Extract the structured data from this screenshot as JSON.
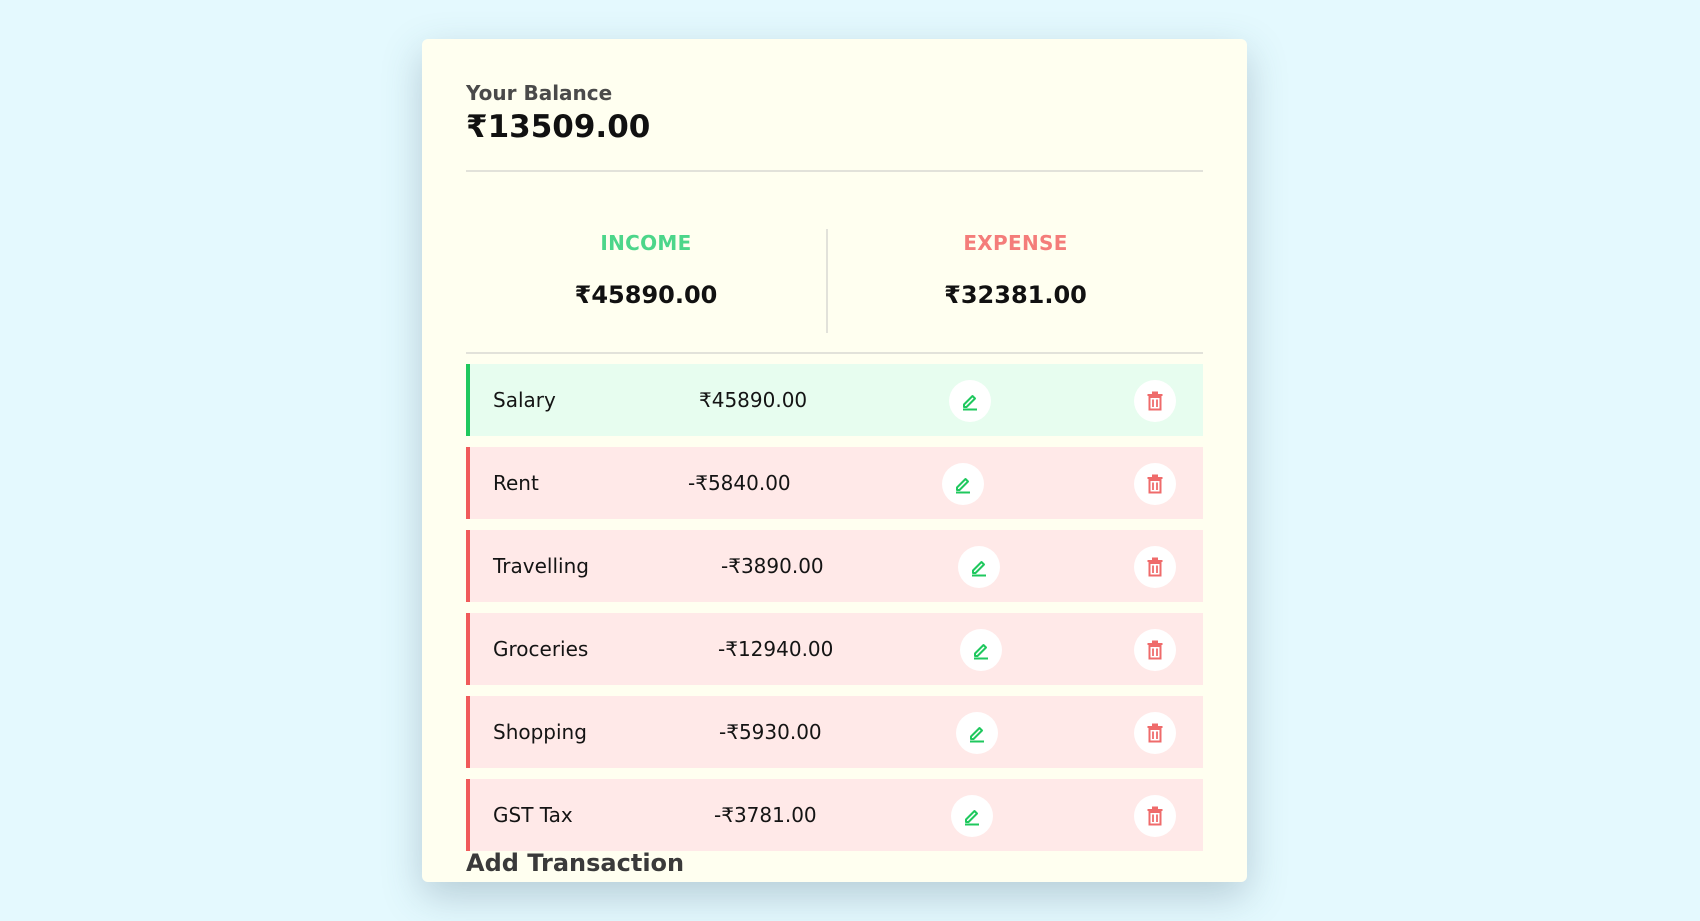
{
  "balance": {
    "label": "Your Balance",
    "value": "₹13509.00"
  },
  "summary": {
    "income_label": "INCOME",
    "income_value": "₹45890.00",
    "expense_label": "EXPENSE",
    "expense_value": "₹32381.00"
  },
  "transactions": [
    {
      "name": "Salary",
      "amount": "₹45890.00",
      "type": "income"
    },
    {
      "name": "Rent",
      "amount": "-₹5840.00",
      "type": "expense"
    },
    {
      "name": "Travelling",
      "amount": "-₹3890.00",
      "type": "expense"
    },
    {
      "name": "Groceries",
      "amount": "-₹12940.00",
      "type": "expense"
    },
    {
      "name": "Shopping",
      "amount": "-₹5930.00",
      "type": "expense"
    },
    {
      "name": "GST Tax",
      "amount": "-₹3781.00",
      "type": "expense"
    }
  ],
  "icons": {
    "edit": "pencil-edit-icon",
    "delete": "trash-icon"
  },
  "colors": {
    "income_accent": "#1fc85e",
    "expense_accent": "#f05a5a",
    "income_title": "#4cd68a",
    "expense_title": "#f47d7a",
    "background": "#e4f9fe",
    "card": "#fffff0"
  },
  "add_transaction": {
    "title": "Add Transaction"
  }
}
